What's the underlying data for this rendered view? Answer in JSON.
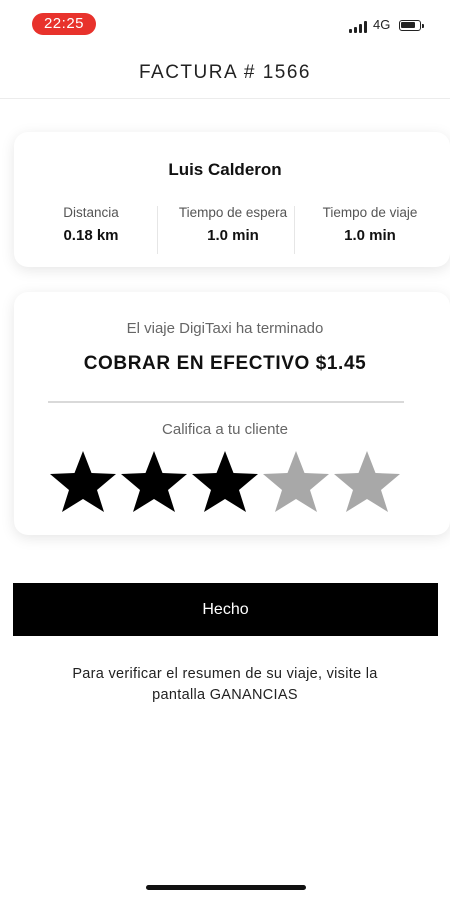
{
  "status_bar": {
    "time": "22:25",
    "network": "4G",
    "signal_icon": "cellular-signal-icon",
    "battery_icon": "battery-icon",
    "time_pill_color": "#e8322c"
  },
  "header": {
    "title": "FACTURA # 1566"
  },
  "trip_card": {
    "client_name": "Luis Calderon",
    "stats": [
      {
        "label": "Distancia",
        "value": "0.18 km"
      },
      {
        "label": "Tiempo de espera",
        "value": "1.0 min"
      },
      {
        "label": "Tiempo de viaje",
        "value": "1.0 min"
      }
    ]
  },
  "payment_card": {
    "trip_done": "El viaje DigiTaxi ha terminado",
    "charge": "COBRAR EN EFECTIVO $1.45",
    "rate_label": "Califica a tu cliente",
    "rating": {
      "value": 3,
      "max": 5
    },
    "star_filled_color": "#000000",
    "star_empty_color": "#a8a8a8"
  },
  "done_button": {
    "label": "Hecho"
  },
  "info": {
    "line1": "Para verificar el resumen de su viaje, visite la",
    "line2": "pantalla GANANCIAS"
  }
}
